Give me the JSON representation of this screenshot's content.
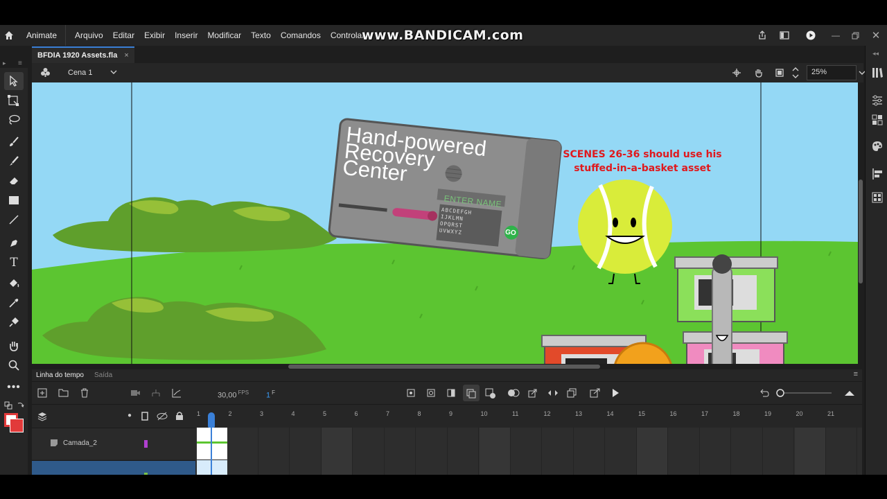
{
  "menubar": {
    "app_name": "Animate",
    "items": [
      "Arquivo",
      "Editar",
      "Exibir",
      "Inserir",
      "Modificar",
      "Texto",
      "Comandos",
      "Controlar"
    ]
  },
  "watermark": "www.BANDICAM.com",
  "document": {
    "tab_title": "BFDIA 1920 Assets.fla",
    "close": "×",
    "scene": "Cena 1",
    "zoom": "25%"
  },
  "stage": {
    "machine_title": "Hand-powered\nRecovery\nCenter",
    "enter_name": "ENTER NAME",
    "go_label": "GO",
    "keyboard_rows": [
      "ABCDEFGH",
      "IJKLMN",
      "OPQRST",
      "UVWXYZ"
    ],
    "note": "SCENES 26-36 should use his stuffed-in-a-basket asset"
  },
  "timeline": {
    "tab_active": "Linha do tempo",
    "tab_inactive": "Saída",
    "fps": "30,00",
    "fps_unit": "FPS",
    "frame": "1",
    "frame_unit": "F",
    "ruler": [
      "1",
      "2",
      "3",
      "4",
      "5",
      "6",
      "7",
      "8",
      "9",
      "10",
      "11",
      "12",
      "13",
      "14",
      "15",
      "16",
      "17",
      "18",
      "19",
      "20",
      "21"
    ],
    "layers": [
      {
        "name": "Camada_2",
        "color": "#b040d0"
      },
      {
        "name": "",
        "color": "#7ac34a"
      }
    ]
  },
  "colors": {
    "accent": "#3a80d8",
    "sky": "#94d8f5",
    "grass": "#5cc531",
    "note_red": "#e0191d"
  }
}
